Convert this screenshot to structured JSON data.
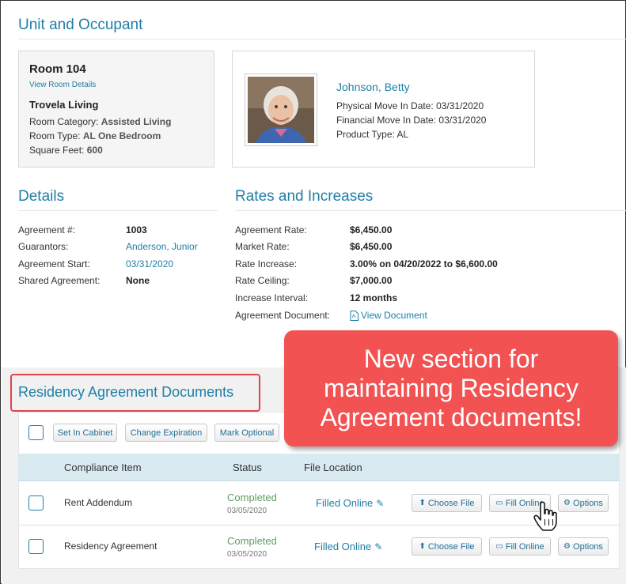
{
  "unit_section": {
    "title": "Unit and Occupant"
  },
  "room": {
    "title": "Room 104",
    "details_link": "View Room Details",
    "company": "Trovela Living",
    "category_label": "Room Category:",
    "category_value": "Assisted Living",
    "type_label": "Room Type:",
    "type_value": "AL One Bedroom",
    "sqft_label": "Square Feet:",
    "sqft_value": "600"
  },
  "occupant": {
    "name": "Johnson, Betty",
    "physical_label": "Physical Move In Date:",
    "physical_value": "03/31/2020",
    "financial_label": "Financial Move In Date:",
    "financial_value": "03/31/2020",
    "product_label": "Product Type:",
    "product_value": "AL"
  },
  "details": {
    "title": "Details",
    "rows": [
      {
        "label": "Agreement #:",
        "value": "1003"
      },
      {
        "label": "Guarantors:",
        "value": "Anderson, Junior"
      },
      {
        "label": "Agreement Start:",
        "value": "03/31/2020"
      },
      {
        "label": "Shared Agreement:",
        "value": "None"
      }
    ]
  },
  "rates": {
    "title": "Rates and Increases",
    "rows": [
      {
        "label": "Agreement Rate:",
        "value": "$6,450.00"
      },
      {
        "label": "Market Rate:",
        "value": "$6,450.00"
      },
      {
        "label": "Rate Increase:",
        "value": "3.00% on 04/20/2022 to $6,600.00"
      },
      {
        "label": "Rate Ceiling:",
        "value": "$7,000.00"
      },
      {
        "label": "Increase Interval:",
        "value": "12 months"
      },
      {
        "label": "Agreement Document:",
        "value": "View Document"
      }
    ]
  },
  "documents": {
    "title": "Residency Agreement Documents",
    "toolbar": {
      "set_in_cabinet": "Set In Cabinet",
      "change_expiration": "Change Expiration",
      "mark_optional": "Mark Optional"
    },
    "columns": {
      "compliance_item": "Compliance Item",
      "status": "Status",
      "file_location": "File Location"
    },
    "rows": [
      {
        "item": "Rent Addendum",
        "status": "Completed",
        "date": "03/05/2020",
        "location": "Filled Online",
        "choose_file": "Choose File",
        "fill_online": "Fill Online",
        "options": "Options"
      },
      {
        "item": "Residency Agreement",
        "status": "Completed",
        "date": "03/05/2020",
        "location": "Filled Online",
        "choose_file": "Choose File",
        "fill_online": "Fill Online",
        "options": "Options"
      }
    ]
  },
  "callout": {
    "line1": "New section for",
    "line2": "maintaining Residency",
    "line3": "Agreement documents!"
  },
  "colors": {
    "accent": "#1f7fa6",
    "callout": "#f25252",
    "highlight_border": "#e3434a",
    "status_green": "#5d9e5d"
  }
}
